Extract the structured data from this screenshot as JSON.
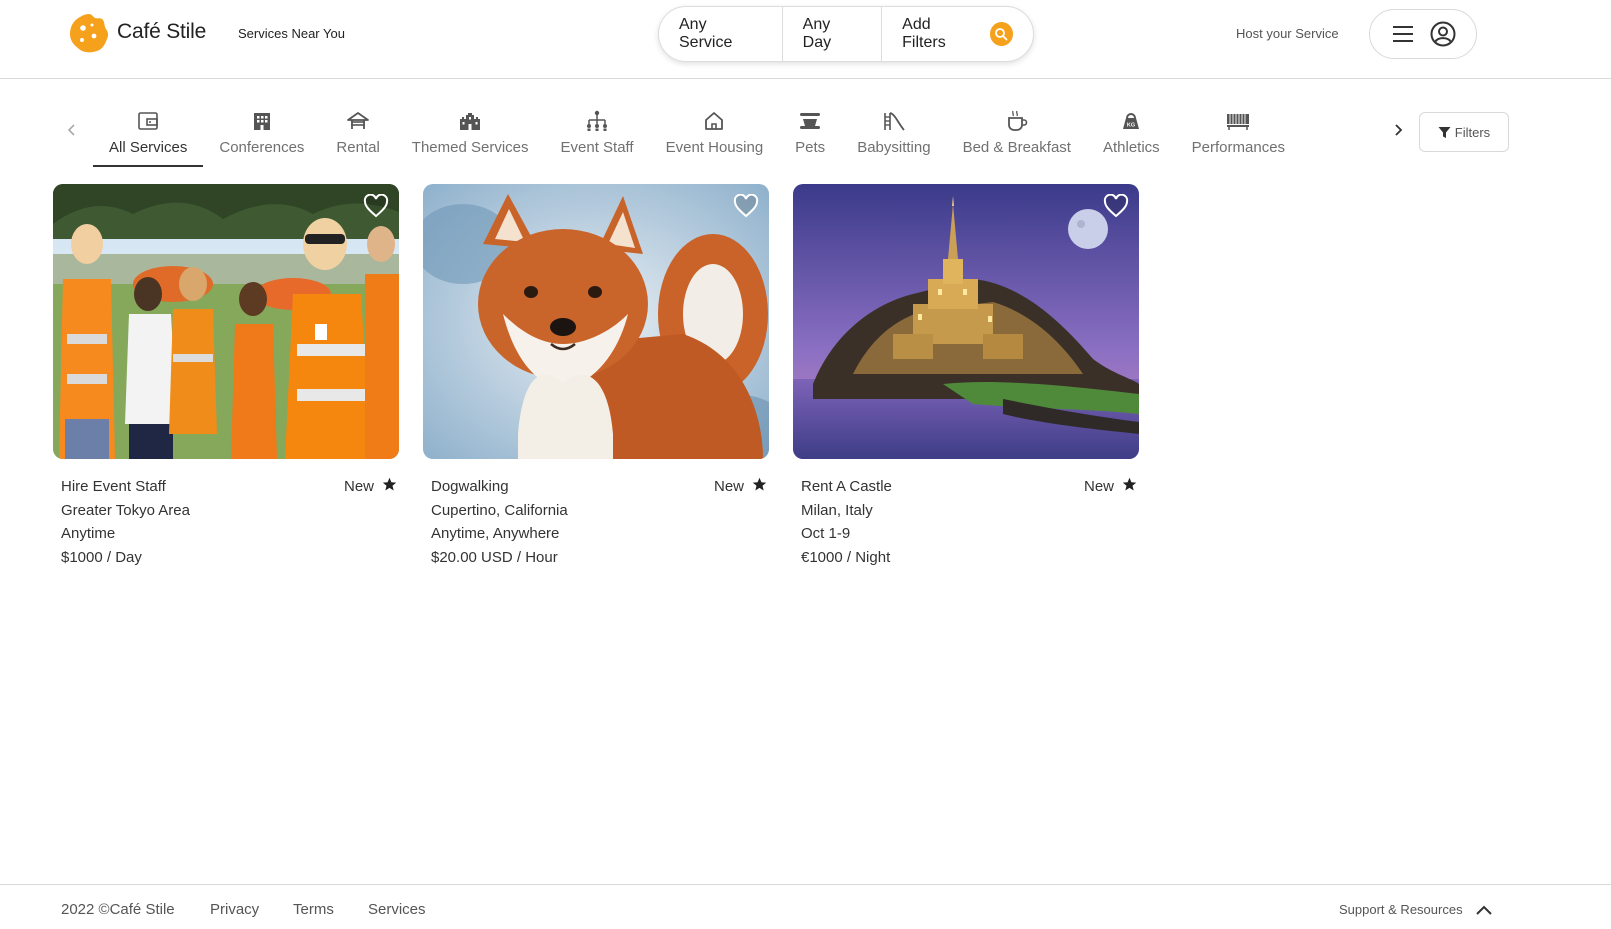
{
  "header": {
    "brand": "Café Stile",
    "nearby_label": "Services Near You",
    "search": {
      "service": "Any Service",
      "day": "Any Day",
      "filters": "Add Filters"
    },
    "host_link": "Host your Service",
    "accent_color": "#f6a11c"
  },
  "categories": {
    "active_index": 0,
    "items": [
      {
        "label": "All Services",
        "icon": "wallet-icon"
      },
      {
        "label": "Conferences",
        "icon": "building-icon"
      },
      {
        "label": "Rental",
        "icon": "gazebo-icon"
      },
      {
        "label": "Themed Services",
        "icon": "castle-icon"
      },
      {
        "label": "Event Staff",
        "icon": "org-chart-icon"
      },
      {
        "label": "Event Housing",
        "icon": "house-icon"
      },
      {
        "label": "Pets",
        "icon": "pet-bowl-icon"
      },
      {
        "label": "Babysitting",
        "icon": "slide-icon"
      },
      {
        "label": "Bed & Breakfast",
        "icon": "mug-icon"
      },
      {
        "label": "Athletics",
        "icon": "kettlebell-icon"
      },
      {
        "label": "Performances",
        "icon": "piano-icon"
      }
    ],
    "filters_label": "Filters"
  },
  "listings": [
    {
      "title": "Hire Event Staff",
      "location": "Greater Tokyo Area",
      "dates": "Anytime",
      "price": "$1000 / Day",
      "badge": "New",
      "image": "event-staff-photo"
    },
    {
      "title": "Dogwalking",
      "location": "Cupertino, California",
      "dates": "Anytime, Anywhere",
      "price": "$20.00 USD / Hour",
      "badge": "New",
      "image": "shiba-dog-photo"
    },
    {
      "title": "Rent A Castle",
      "location": "Milan, Italy",
      "dates": "Oct 1-9",
      "price": "€1000 / Night",
      "badge": "New",
      "image": "castle-photo"
    }
  ],
  "footer": {
    "copyright": "2022 ©Café Stile",
    "links": [
      "Privacy",
      "Terms",
      "Services"
    ],
    "support": "Support & Resources"
  }
}
